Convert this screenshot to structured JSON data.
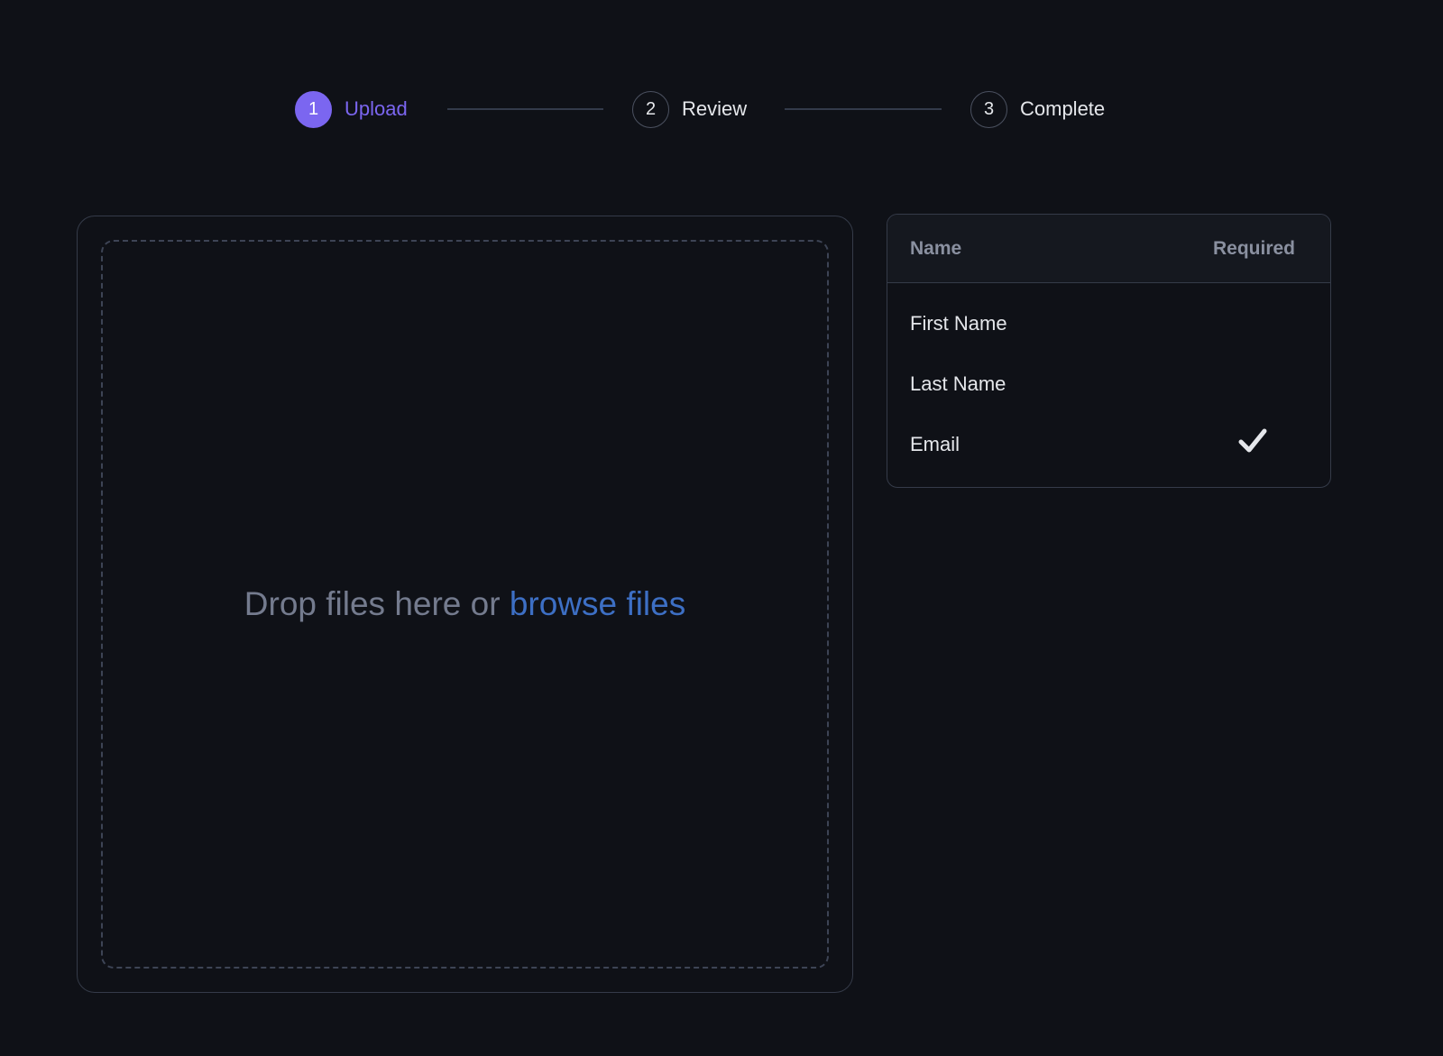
{
  "stepper": {
    "steps": [
      {
        "number": "1",
        "label": "Upload",
        "state": "active"
      },
      {
        "number": "2",
        "label": "Review",
        "state": "pending"
      },
      {
        "number": "3",
        "label": "Complete",
        "state": "pending"
      }
    ]
  },
  "upload": {
    "prompt": "Drop files here or",
    "browse_label": "browse files"
  },
  "fields_table": {
    "columns": {
      "name": "Name",
      "required": "Required"
    },
    "rows": [
      {
        "name": "First Name",
        "required": false
      },
      {
        "name": "Last Name",
        "required": false
      },
      {
        "name": "Email",
        "required": true
      }
    ]
  },
  "icons": {
    "required_indicator": "checkmark-icon"
  },
  "colors": {
    "background": "#0f1117",
    "accent": "#7b66f0",
    "link": "#3d6fc4",
    "border": "#353b49"
  }
}
